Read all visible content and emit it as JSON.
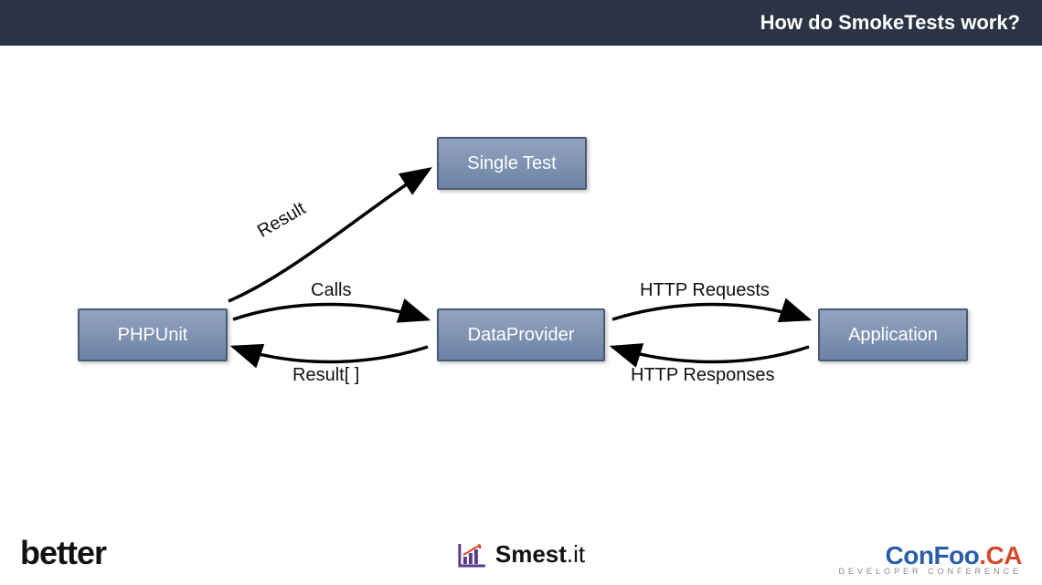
{
  "header": {
    "title": "How do SmokeTests work?"
  },
  "nodes": {
    "phpunit": {
      "label": "PHPUnit"
    },
    "single_test": {
      "label": "Single Test"
    },
    "dataprovider": {
      "label": "DataProvider"
    },
    "application": {
      "label": "Application"
    }
  },
  "edges": {
    "result": {
      "label": "Result"
    },
    "calls": {
      "label": "Calls"
    },
    "result_array": {
      "label": "Result[ ]"
    },
    "http_requests": {
      "label": "HTTP Requests"
    },
    "http_responses": {
      "label": "HTTP Responses"
    }
  },
  "footer": {
    "better": {
      "text": "better"
    },
    "smest": {
      "text_bold": "Smest",
      "text_thin": ".it"
    },
    "confoo": {
      "main_a": "ConFoo",
      "main_b": ".CA",
      "sub": "DEVELOPER CONFERENCE"
    }
  }
}
